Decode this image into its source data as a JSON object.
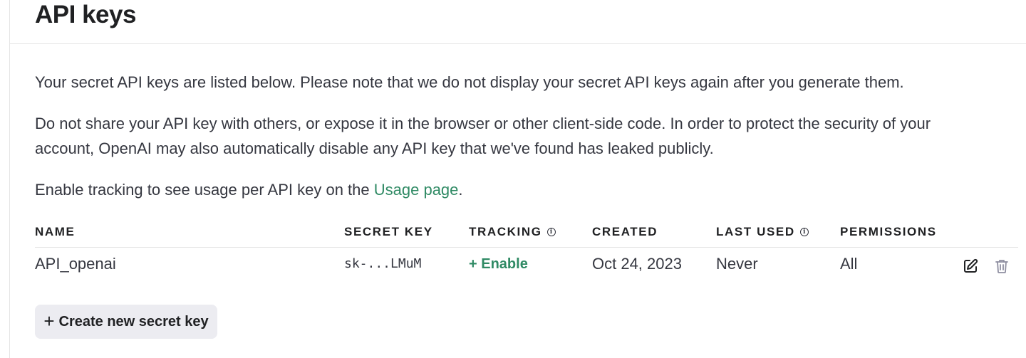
{
  "page": {
    "title": "API keys"
  },
  "intro": {
    "p1": "Your secret API keys are listed below. Please note that we do not display your secret API keys again after you generate them.",
    "p2": "Do not share your API key with others, or expose it in the browser or other client-side code. In order to protect the security of your account, OpenAI may also automatically disable any API key that we've found has leaked publicly.",
    "p3_prefix": "Enable tracking to see usage per API key on the ",
    "p3_link": "Usage page",
    "p3_suffix": "."
  },
  "table": {
    "columns": {
      "name": "NAME",
      "secret_key": "SECRET KEY",
      "tracking": "TRACKING",
      "created": "CREATED",
      "last_used": "LAST USED",
      "permissions": "PERMISSIONS"
    },
    "rows": [
      {
        "name": "API_openai",
        "secret_key": "sk-...LMuM",
        "tracking": "+ Enable",
        "created": "Oct 24, 2023",
        "last_used": "Never",
        "permissions": "All"
      }
    ]
  },
  "actions": {
    "create_label": "Create new secret key",
    "create_icon": "plus-icon",
    "edit_icon": "edit-icon",
    "delete_icon": "trash-icon"
  },
  "colors": {
    "link_green": "#2f8a64",
    "button_bg": "#ececf1",
    "text": "#353740",
    "border": "#e5e5e5"
  }
}
